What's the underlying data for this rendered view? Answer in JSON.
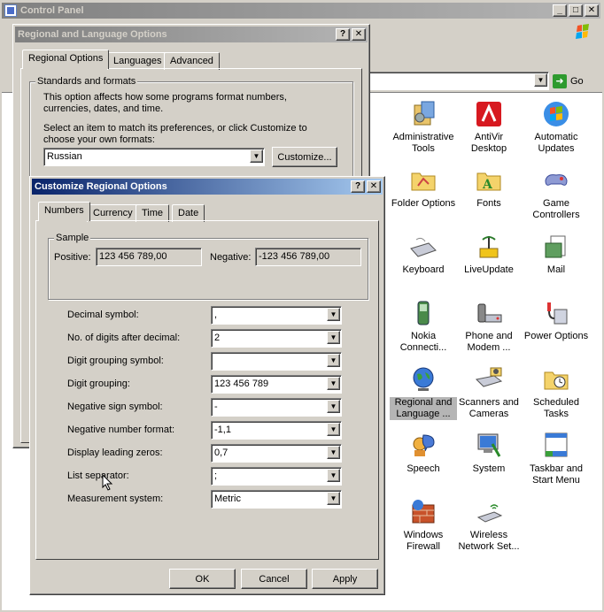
{
  "control_panel": {
    "title": "Control Panel",
    "go_label": "Go",
    "items": [
      {
        "label": "Administrative Tools",
        "icon": "admin-tools-icon"
      },
      {
        "label": "AntiVir Desktop",
        "icon": "antivir-icon"
      },
      {
        "label": "Automatic Updates",
        "icon": "windows-update-icon"
      },
      {
        "label": "Folder Options",
        "icon": "folder-icon"
      },
      {
        "label": "Fonts",
        "icon": "fonts-folder-icon"
      },
      {
        "label": "Game Controllers",
        "icon": "gamepad-icon"
      },
      {
        "label": "Keyboard",
        "icon": "keyboard-icon"
      },
      {
        "label": "LiveUpdate",
        "icon": "liveupdate-icon"
      },
      {
        "label": "Mail",
        "icon": "mail-icon"
      },
      {
        "label": "Nokia Connecti...",
        "icon": "phone-icon"
      },
      {
        "label": "Phone and Modem ...",
        "icon": "phone-modem-icon"
      },
      {
        "label": "Power Options",
        "icon": "power-icon"
      },
      {
        "label": "Regional and Language ...",
        "icon": "globe-icon"
      },
      {
        "label": "Scanners and Cameras",
        "icon": "scanner-icon"
      },
      {
        "label": "Scheduled Tasks",
        "icon": "scheduled-tasks-icon"
      },
      {
        "label": "Speech",
        "icon": "speech-icon"
      },
      {
        "label": "System",
        "icon": "system-icon"
      },
      {
        "label": "Taskbar and Start Menu",
        "icon": "taskbar-icon"
      },
      {
        "label": "Windows Firewall",
        "icon": "firewall-icon"
      },
      {
        "label": "Wireless Network Set...",
        "icon": "wireless-icon"
      }
    ]
  },
  "regional_dialog": {
    "title": "Regional and Language Options",
    "tabs": [
      "Regional Options",
      "Languages",
      "Advanced"
    ],
    "group_title": "Standards and formats",
    "description": "This option affects how some programs format numbers, currencies, dates, and time.",
    "select_prompt": "Select an item to match its preferences, or click Customize to choose your own formats:",
    "format_value": "Russian",
    "customize_label": "Customize..."
  },
  "customize_dialog": {
    "title": "Customize Regional Options",
    "tabs": [
      "Numbers",
      "Currency",
      "Time",
      "Date"
    ],
    "sample": {
      "title": "Sample",
      "positive_label": "Positive:",
      "positive_value": "123 456 789,00",
      "negative_label": "Negative:",
      "negative_value": "-123 456 789,00"
    },
    "fields": [
      {
        "label": "Decimal symbol:",
        "value": ","
      },
      {
        "label": "No. of digits after decimal:",
        "value": "2"
      },
      {
        "label": "Digit grouping symbol:",
        "value": ""
      },
      {
        "label": "Digit grouping:",
        "value": "123 456 789"
      },
      {
        "label": "Negative sign symbol:",
        "value": "-"
      },
      {
        "label": "Negative number format:",
        "value": "-1,1"
      },
      {
        "label": "Display leading zeros:",
        "value": "0,7"
      },
      {
        "label": "List separator:",
        "value": ";"
      },
      {
        "label": "Measurement system:",
        "value": "Metric"
      }
    ],
    "buttons": {
      "ok": "OK",
      "cancel": "Cancel",
      "apply": "Apply"
    }
  },
  "colors": {
    "active_title": "#0a246a",
    "inactive_title": "#808080",
    "face": "#d4d0c8"
  }
}
